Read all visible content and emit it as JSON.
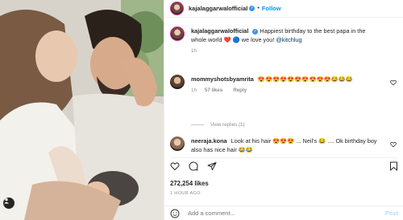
{
  "post": {
    "author": "kajalaggarwalofficial",
    "follow_label": "Follow",
    "separator": "•",
    "caption_author": "kajalaggarwalofficial",
    "caption_text": "Happiest birthday to the best papa in the whole world ❤️ 🔵 we love you! ",
    "caption_mention": "@kitchlug",
    "caption_age": "1h",
    "likes": "272,254 likes",
    "time_ago": "1 HOUR AGO",
    "add_comment_placeholder": "Add a comment...",
    "post_label": "Post"
  },
  "comments": [
    {
      "author": "mommyshotsbyamrita",
      "text": "😍😍😍😍😍😍😍😍😍😍😂😂😂",
      "age": "1h",
      "likes": "57 likes",
      "reply_label": "Reply",
      "view_replies": "View replies (1)"
    },
    {
      "author": "neeraja.kona",
      "text": "Look at his hair 😍😍😍 ... Neil's 😂 .... Ok birthday boy also has nice hair 😂😂"
    }
  ],
  "colors": {
    "accent": "#0095f6",
    "verified": "#3897f0",
    "muted": "#8e8e8e"
  }
}
